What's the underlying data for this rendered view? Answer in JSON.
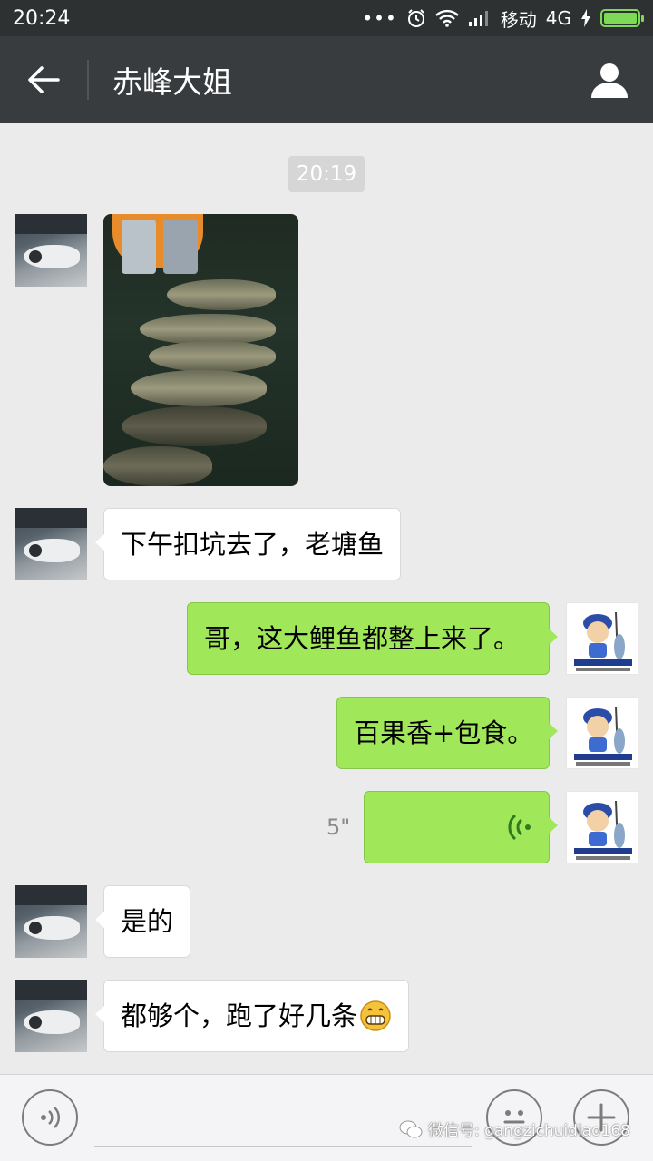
{
  "status_bar": {
    "time": "20:24",
    "dots": "•••",
    "carrier": "移动",
    "network": "4G"
  },
  "header": {
    "title": "赤峰大姐"
  },
  "chat": {
    "timestamp": "20:19",
    "messages": [
      {
        "from": "other",
        "type": "image"
      },
      {
        "from": "other",
        "type": "text",
        "text": "下午扣坑去了，老塘鱼"
      },
      {
        "from": "me",
        "type": "text",
        "text": "哥，这大鲤鱼都整上来了。"
      },
      {
        "from": "me",
        "type": "text",
        "text": "百果香+包食。"
      },
      {
        "from": "me",
        "type": "voice",
        "duration": "5\""
      },
      {
        "from": "other",
        "type": "text",
        "text": "是的"
      },
      {
        "from": "other",
        "type": "text",
        "text": "都够个，跑了好几条",
        "emoji": "grinning-face"
      }
    ],
    "my_avatar_caption": "钢子垂钓俱乐部",
    "my_avatar_caption_en": "GANGZI FISHING CLUB"
  },
  "input_bar": {
    "voice_icon": "voice-input-icon",
    "emoji_icon": "emoji-icon",
    "more_icon": "plus-icon"
  },
  "watermark": {
    "text": "微信号: gangzichuidiao168"
  },
  "colors": {
    "status_bg": "#2e3132",
    "header_bg": "#383c3e",
    "chat_bg": "#ebebeb",
    "outgoing_bubble": "#a0e759",
    "incoming_bubble": "#ffffff",
    "battery": "#7ed957"
  }
}
